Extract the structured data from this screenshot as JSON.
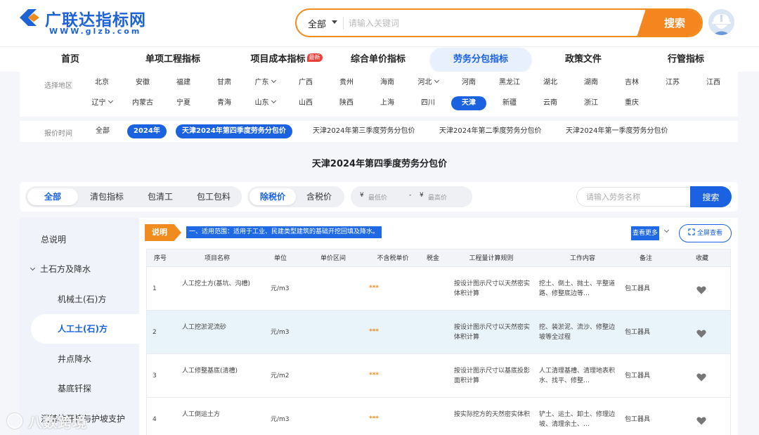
{
  "header": {
    "logo_text": "广联达指标网",
    "logo_url": "WWW.glzb.com",
    "search_scope": "全部",
    "search_placeholder": "请输入关键词",
    "search_button": "搜索"
  },
  "nav": {
    "items": [
      {
        "label": "首页"
      },
      {
        "label": "单项工程指标"
      },
      {
        "label": "项目成本指标",
        "badge": "最新"
      },
      {
        "label": "综合单价指标"
      },
      {
        "label": "劳务分包指标",
        "active": true
      },
      {
        "label": "政策文件"
      },
      {
        "label": "行管指标"
      }
    ]
  },
  "region": {
    "label": "选择地区",
    "row1": [
      "北京",
      "安徽",
      "福建",
      "甘肃",
      "广东",
      "广西",
      "贵州",
      "海南",
      "河北",
      "河南",
      "黑龙江",
      "湖北",
      "湖南",
      "吉林",
      "江苏",
      "江西"
    ],
    "row2": [
      "辽宁",
      "内蒙古",
      "宁夏",
      "青海",
      "山东",
      "山西",
      "陕西",
      "上海",
      "四川",
      "天津",
      "新疆",
      "云南",
      "浙江",
      "重庆"
    ],
    "active": "天津"
  },
  "period": {
    "label": "报价时间",
    "items": [
      "全部",
      "2024年",
      "天津2024年第四季度劳务分包价",
      "天津2024年第三季度劳务分包价",
      "天津2024年第二季度劳务分包价",
      "天津2024年第一季度劳务分包价"
    ]
  },
  "page_title": "天津2024年第四季度劳务分包价",
  "filter": {
    "types": [
      "全部",
      "清包指标",
      "包清工",
      "包工包料"
    ],
    "tax": [
      "除税价",
      "含税价"
    ],
    "min_price": "最低价",
    "max_price": "最高价",
    "currency": "¥",
    "dash": "-",
    "name_placeholder": "请输入劳务名称",
    "search_button": "搜索"
  },
  "sidebar": {
    "items": [
      {
        "label": "总说明"
      },
      {
        "label": "土石方及降水",
        "group": true
      },
      {
        "label": "机械土(石)方"
      },
      {
        "label": "人工土(石)方",
        "active": true
      },
      {
        "label": "井点降水"
      },
      {
        "label": "基底钎探"
      },
      {
        "label": "沉基坑开挖与护坡支护"
      }
    ]
  },
  "notice": {
    "tag": "说明",
    "text": "一、适用范围：适用于工业、民建类型建筑的基础开挖回填及降水。",
    "more": "查看更多",
    "fullscreen": "全屏查看"
  },
  "table": {
    "headers": [
      "序号",
      "项目名称",
      "单位",
      "单价区间",
      "不含税单价",
      "税金",
      "工程量计算规则",
      "工作内容",
      "备注",
      "收藏"
    ],
    "rows": [
      {
        "no": "1",
        "name": "人工挖土方(基坑、沟槽)",
        "unit": "元/m3",
        "price": "***",
        "rule": "按设计图示尺寸以天然密实体积计算",
        "work": "挖土、倒土、抛土、平整道路、修整底边等…",
        "note": "包工器具"
      },
      {
        "no": "2",
        "name": "人工挖淤泥流砂",
        "unit": "元/m3",
        "price": "***",
        "rule": "按设计图示尺寸以天然密实体积计算",
        "work": "挖、装淤泥、流沙、修整边坡等全过程",
        "note": "包工器具"
      },
      {
        "no": "3",
        "name": "人工修整基底(清槽)",
        "unit": "元/m2",
        "price": "***",
        "rule": "按设计图示尺寸以基底投影面积计算",
        "work": "人工清理基槽、清理地表积水、找平、修整…",
        "note": "包工器具"
      },
      {
        "no": "4",
        "name": "人工倒运土方",
        "unit": "元/m3",
        "price": "***",
        "rule": "按实际挖方的天然密实体积",
        "work": "铲土、运土、卸土、修理边坡、清理余土、…",
        "note": "包工器具"
      }
    ]
  },
  "watermark": "八数跨境",
  "colors": {
    "primary": "#1a62e0",
    "accent": "#f08c1e",
    "highlight_row": "#e8f3fa"
  }
}
